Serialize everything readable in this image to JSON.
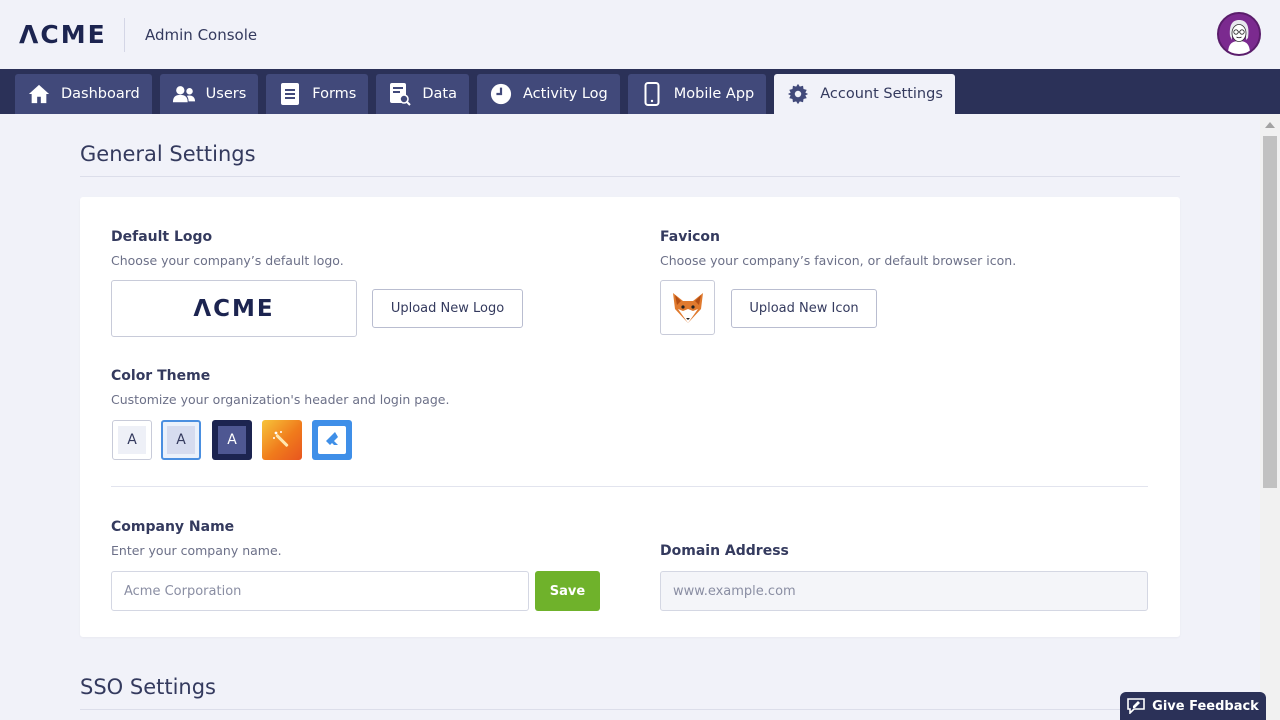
{
  "header": {
    "logo": "ΛCME",
    "app_title": "Admin Console"
  },
  "nav": {
    "tabs": [
      {
        "label": "Dashboard",
        "icon": "home-icon"
      },
      {
        "label": "Users",
        "icon": "users-icon"
      },
      {
        "label": "Forms",
        "icon": "forms-icon"
      },
      {
        "label": "Data",
        "icon": "data-icon"
      },
      {
        "label": "Activity Log",
        "icon": "clock-icon"
      },
      {
        "label": "Mobile App",
        "icon": "mobile-icon"
      },
      {
        "label": "Account Settings",
        "icon": "gear-icon",
        "active": true
      }
    ]
  },
  "general": {
    "title": "General Settings",
    "default_logo": {
      "label": "Default Logo",
      "hint": "Choose your company’s default logo.",
      "preview_text": "ΛCME",
      "button": "Upload New Logo"
    },
    "favicon": {
      "label": "Favicon",
      "hint": "Choose your company’s favicon, or default browser icon.",
      "button": "Upload New Icon"
    },
    "color_theme": {
      "label": "Color Theme",
      "hint": "Customize your organization's header and login page.",
      "swatches": [
        {
          "letter": "A",
          "name": "light"
        },
        {
          "letter": "A",
          "name": "light-blue",
          "selected": true
        },
        {
          "letter": "A",
          "name": "navy"
        },
        {
          "letter": "",
          "name": "sunset"
        },
        {
          "letter": "",
          "name": "blue-brand"
        }
      ]
    },
    "company_name": {
      "label": "Company Name",
      "hint": "Enter your company name.",
      "placeholder": "Acme Corporation",
      "save": "Save"
    },
    "domain": {
      "label": "Domain Address",
      "placeholder": "www.example.com"
    }
  },
  "sso": {
    "title": "SSO Settings"
  },
  "feedback": {
    "label": "Give Feedback"
  },
  "colors": {
    "nav_bg": "#2b3158",
    "tab_bg": "#41497a",
    "save_green": "#6fb22b",
    "page_bg": "#f1f2f9"
  }
}
